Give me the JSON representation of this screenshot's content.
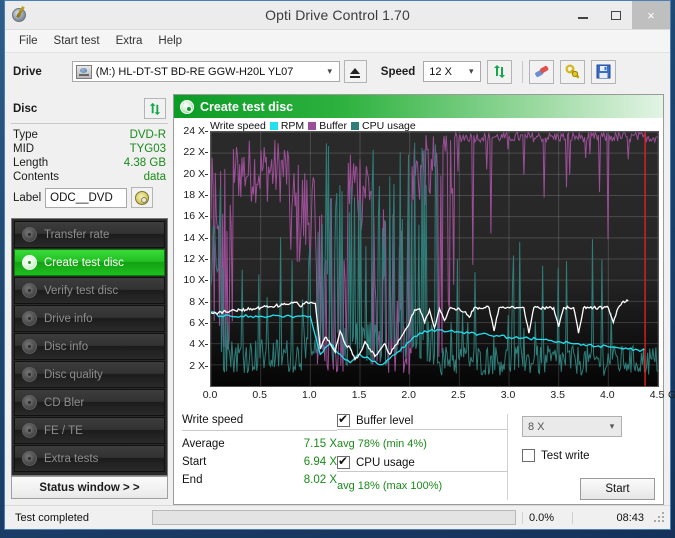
{
  "window": {
    "title": "Opti Drive Control 1.70",
    "app_icon": "disc-pen-icon",
    "minimize": "minimize-icon",
    "maximize": "maximize-icon",
    "close": "×"
  },
  "menu": {
    "items": [
      "File",
      "Start test",
      "Extra",
      "Help"
    ]
  },
  "toolbar": {
    "drive_label": "Drive",
    "drive_value": "(M:)  HL-DT-ST BD-RE  GGW-H20L YL07",
    "eject": "eject-icon",
    "speed_label": "Speed",
    "speed_value": "12 X",
    "refresh": "refresh-icon",
    "erase": "eraser-icon",
    "tools": "wrench-icon",
    "save": "save-icon"
  },
  "disc": {
    "title": "Disc",
    "refresh": "refresh-icon",
    "rows": [
      {
        "key": "Type",
        "value": "DVD-R"
      },
      {
        "key": "MID",
        "value": "TYG03"
      },
      {
        "key": "Length",
        "value": "4.38 GB"
      },
      {
        "key": "Contents",
        "value": "data"
      }
    ],
    "label_key": "Label",
    "label_value": "ODC__DVD",
    "label_button": "disc-icon"
  },
  "sidebar": {
    "items": [
      {
        "label": "Transfer rate",
        "active": false
      },
      {
        "label": "Create test disc",
        "active": true
      },
      {
        "label": "Verify test disc",
        "active": false
      },
      {
        "label": "Drive info",
        "active": false
      },
      {
        "label": "Disc info",
        "active": false
      },
      {
        "label": "Disc quality",
        "active": false
      },
      {
        "label": "CD Bler",
        "active": false
      },
      {
        "label": "FE / TE",
        "active": false
      },
      {
        "label": "Extra tests",
        "active": false
      }
    ],
    "status_window": "Status window > >"
  },
  "pane": {
    "title": "Create test disc",
    "icon": "disc-icon"
  },
  "stats": {
    "write_speed_title": "Write speed",
    "rows": [
      {
        "key": "Average",
        "value": "7.15 X"
      },
      {
        "key": "Start",
        "value": "6.94 X"
      },
      {
        "key": "End",
        "value": "8.02 X"
      }
    ],
    "buffer_label": "Buffer level",
    "buffer_checked": true,
    "buffer_text": "avg 78% (min 4%)",
    "cpu_label": "CPU usage",
    "cpu_checked": true,
    "cpu_text": "avg 18% (max 100%)",
    "speed_select": "8 X",
    "test_write_label": "Test write",
    "test_write_checked": false,
    "start_button": "Start"
  },
  "statusbar": {
    "message": "Test completed",
    "progress_pct": "0.0%",
    "progress_value": 0,
    "time": "08:43"
  },
  "colors": {
    "write_speed": "#ffffff",
    "rpm": "#22e0f0",
    "buffer": "#9b4f96",
    "cpu": "#2e7d78",
    "end_marker": "#e02020",
    "accent_green": "#1a8a1a",
    "header_green": "#0a9c26"
  },
  "chart_data": {
    "type": "line",
    "title": "Create test disc",
    "xlabel": "GB",
    "ylabel": "X",
    "xlim": [
      0.0,
      4.5
    ],
    "ylim": [
      0,
      24
    ],
    "xticks": [
      "0.0",
      "0.5",
      "1.0",
      "1.5",
      "2.0",
      "2.5",
      "3.0",
      "3.5",
      "4.0",
      "4.5"
    ],
    "x_unit": "GB",
    "yticks": [
      "2 X",
      "4 X",
      "6 X",
      "8 X",
      "10 X",
      "12 X",
      "14 X",
      "16 X",
      "18 X",
      "20 X",
      "22 X",
      "24 X"
    ],
    "grid": true,
    "legend_position": "top-left",
    "end_marker_x": 4.37,
    "series": [
      {
        "name": "Write speed",
        "color": "#ffffff",
        "x": [
          0.0,
          0.05,
          0.1,
          0.15,
          0.2,
          0.25,
          0.3,
          0.35,
          0.4,
          0.45,
          0.5,
          0.55,
          0.6,
          0.65,
          0.7,
          0.75,
          0.8,
          0.85,
          0.9,
          0.95,
          1.0,
          1.05,
          1.1,
          1.15,
          1.2,
          1.25,
          1.3,
          1.35,
          1.4,
          1.45,
          1.5,
          1.55,
          1.6,
          1.65,
          1.7,
          1.75,
          1.8,
          1.85,
          1.9,
          1.95,
          2.0,
          2.05,
          2.1,
          2.15,
          2.2,
          2.25,
          2.3,
          2.35,
          2.4,
          2.45,
          2.5,
          2.55,
          2.6,
          2.65,
          2.7,
          2.75,
          2.8,
          2.85,
          2.9,
          2.95,
          3.0,
          3.05,
          3.1,
          3.15,
          3.2,
          3.25,
          3.3,
          3.35,
          3.4,
          3.45,
          3.5,
          3.55,
          3.6,
          3.65,
          3.7,
          3.75,
          3.8,
          3.85,
          3.9,
          3.95,
          4.0,
          4.05,
          4.1,
          4.15,
          4.2,
          4.25,
          4.3,
          4.35,
          4.37
        ],
        "y": [
          6.94,
          6.9,
          7.0,
          7.0,
          7.1,
          7.1,
          7.2,
          7.2,
          7.3,
          7.3,
          7.4,
          7.5,
          7.5,
          7.6,
          7.6,
          7.7,
          7.8,
          7.9,
          7.5,
          7.9,
          7.9,
          7.8,
          3.5,
          4.6,
          4.0,
          3.2,
          5.2,
          4.0,
          3.6,
          2.5,
          3.1,
          4.2,
          3.5,
          2.8,
          3.4,
          4.0,
          3.0,
          3.8,
          4.4,
          5.2,
          6.0,
          7.2,
          7.3,
          6.0,
          7.2,
          5.5,
          7.3,
          6.2,
          7.3,
          7.3,
          7.3,
          7.0,
          6.5,
          7.4,
          7.4,
          7.4,
          7.4,
          5.2,
          7.4,
          7.4,
          7.4,
          7.4,
          7.4,
          7.4,
          5.0,
          7.4,
          7.4,
          7.4,
          7.4,
          7.4,
          5.6,
          7.4,
          7.4,
          7.4,
          5.0,
          7.4,
          7.4,
          7.4,
          7.4,
          7.4,
          7.4,
          6.0,
          7.4,
          8.0,
          8.02
        ]
      },
      {
        "name": "RPM",
        "color": "#22e0f0",
        "x": [
          0.0,
          0.1,
          0.2,
          0.3,
          0.4,
          0.5,
          0.6,
          0.7,
          0.8,
          0.9,
          1.0,
          1.1,
          1.2,
          1.3,
          1.4,
          1.5,
          1.6,
          1.7,
          1.8,
          1.9,
          2.0,
          2.1,
          2.2,
          2.3,
          2.4,
          2.5,
          2.6,
          2.7,
          2.8,
          2.9,
          3.0,
          3.1,
          3.2,
          3.3,
          3.4,
          3.5,
          3.6,
          3.7,
          3.8,
          3.9,
          4.0,
          4.1,
          4.2,
          4.3,
          4.37
        ],
        "y": [
          7.0,
          6.6,
          6.6,
          6.6,
          6.6,
          6.6,
          6.6,
          6.6,
          6.6,
          6.6,
          6.6,
          3.0,
          4.0,
          3.0,
          2.2,
          3.0,
          2.5,
          2.0,
          2.6,
          3.3,
          4.2,
          5.0,
          5.2,
          5.3,
          5.2,
          5.1,
          5.0,
          4.9,
          4.8,
          4.7,
          4.6,
          4.5,
          4.5,
          4.4,
          4.3,
          4.2,
          4.1,
          4.0,
          3.9,
          3.8,
          3.7,
          3.6,
          3.5,
          3.4,
          3.4
        ]
      },
      {
        "name": "Buffer",
        "color": "#9b4f96",
        "note": "percentage trace scaled to 0-24X axis; avg 78%, min 4%",
        "avg_pct": 78,
        "min_pct": 4
      },
      {
        "name": "CPU usage",
        "color": "#2e7d78",
        "note": "percentage trace scaled to 0-24X axis; avg 18%, max 100%",
        "avg_pct": 18,
        "max_pct": 100
      }
    ]
  }
}
